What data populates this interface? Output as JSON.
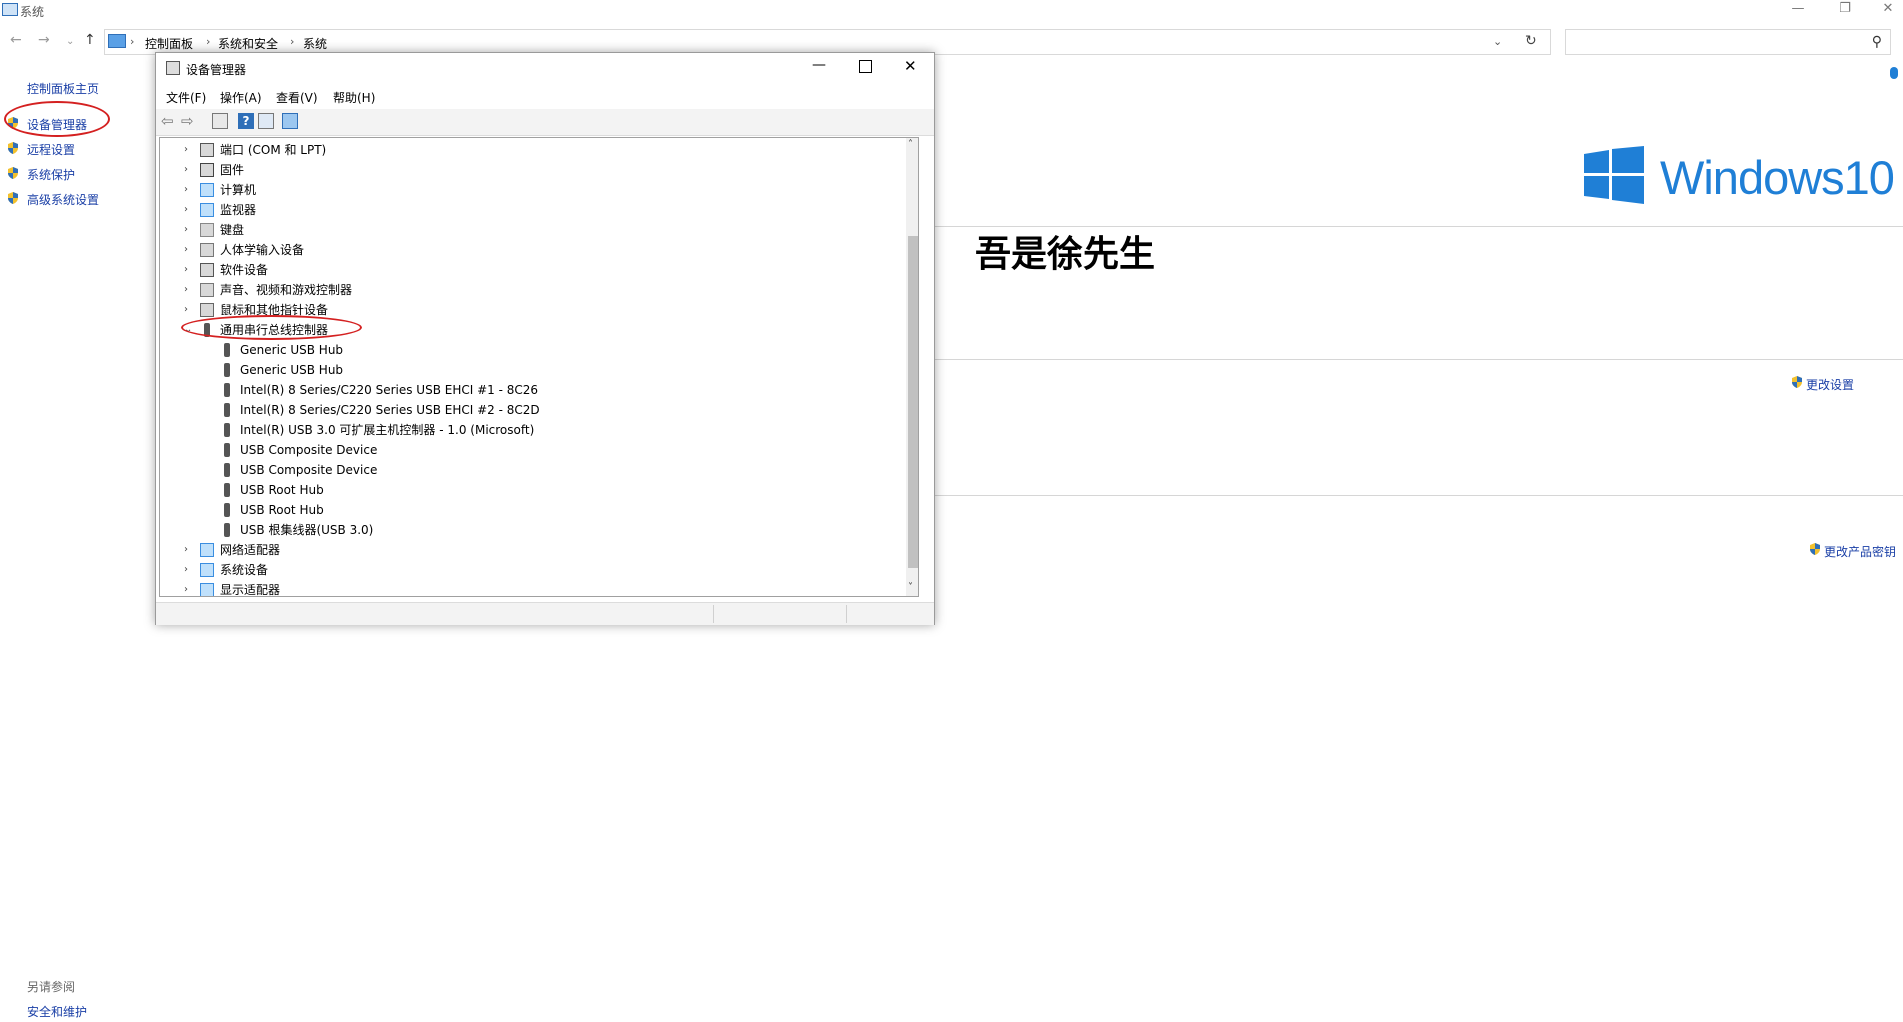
{
  "window": {
    "title": "系统"
  },
  "address": {
    "crumbs": [
      "控制面板",
      "系统和安全",
      "系统"
    ],
    "search_placeholder": ""
  },
  "left_pane": {
    "home": "控制面板主页",
    "items": [
      "设备管理器",
      "远程设置",
      "系统保护",
      "高级系统设置"
    ],
    "see_also_heading": "另请参阅",
    "see_also_items": [
      "安全和维护"
    ]
  },
  "main": {
    "logo_text": "Windows10",
    "owner": "吾是徐先生",
    "change_settings": "更改设置",
    "change_product_key": "更改产品密钥"
  },
  "device_manager": {
    "title": "设备管理器",
    "menu": [
      "文件(F)",
      "操作(A)",
      "查看(V)",
      "帮助(H)"
    ],
    "tree": [
      {
        "label": "端口 (COM 和 LPT)",
        "icon": "port-icon",
        "level": 0
      },
      {
        "label": "固件",
        "icon": "firmware-icon",
        "level": 0
      },
      {
        "label": "计算机",
        "icon": "computer-icon",
        "level": 0
      },
      {
        "label": "监视器",
        "icon": "monitor-icon",
        "level": 0
      },
      {
        "label": "键盘",
        "icon": "keyboard-icon",
        "level": 0
      },
      {
        "label": "人体学输入设备",
        "icon": "hid-icon",
        "level": 0
      },
      {
        "label": "软件设备",
        "icon": "software-device-icon",
        "level": 0
      },
      {
        "label": "声音、视频和游戏控制器",
        "icon": "sound-icon",
        "level": 0
      },
      {
        "label": "鼠标和其他指针设备",
        "icon": "mouse-icon",
        "level": 0
      },
      {
        "label": "通用串行总线控制器",
        "icon": "usb-icon",
        "level": 0,
        "expanded": true
      },
      {
        "label": "Generic USB Hub",
        "icon": "usb-icon",
        "level": 1
      },
      {
        "label": "Generic USB Hub",
        "icon": "usb-icon",
        "level": 1
      },
      {
        "label": "Intel(R) 8 Series/C220 Series USB EHCI #1 - 8C26",
        "icon": "usb-icon",
        "level": 1
      },
      {
        "label": "Intel(R) 8 Series/C220 Series USB EHCI #2 - 8C2D",
        "icon": "usb-icon",
        "level": 1
      },
      {
        "label": "Intel(R) USB 3.0 可扩展主机控制器 - 1.0 (Microsoft)",
        "icon": "usb-icon",
        "level": 1
      },
      {
        "label": "USB Composite Device",
        "icon": "usb-icon",
        "level": 1
      },
      {
        "label": "USB Composite Device",
        "icon": "usb-icon",
        "level": 1
      },
      {
        "label": "USB Root Hub",
        "icon": "usb-icon",
        "level": 1
      },
      {
        "label": "USB Root Hub",
        "icon": "usb-icon",
        "level": 1
      },
      {
        "label": "USB 根集线器(USB 3.0)",
        "icon": "usb-icon",
        "level": 1
      },
      {
        "label": "网络适配器",
        "icon": "network-icon",
        "level": 0
      },
      {
        "label": "系统设备",
        "icon": "system-device-icon",
        "level": 0
      },
      {
        "label": "显示适配器",
        "icon": "display-adapter-icon",
        "level": 0
      }
    ]
  },
  "colors": {
    "link": "#1a3fa6",
    "annotation_red": "#d42020",
    "windows_blue": "#1f7fd6"
  }
}
